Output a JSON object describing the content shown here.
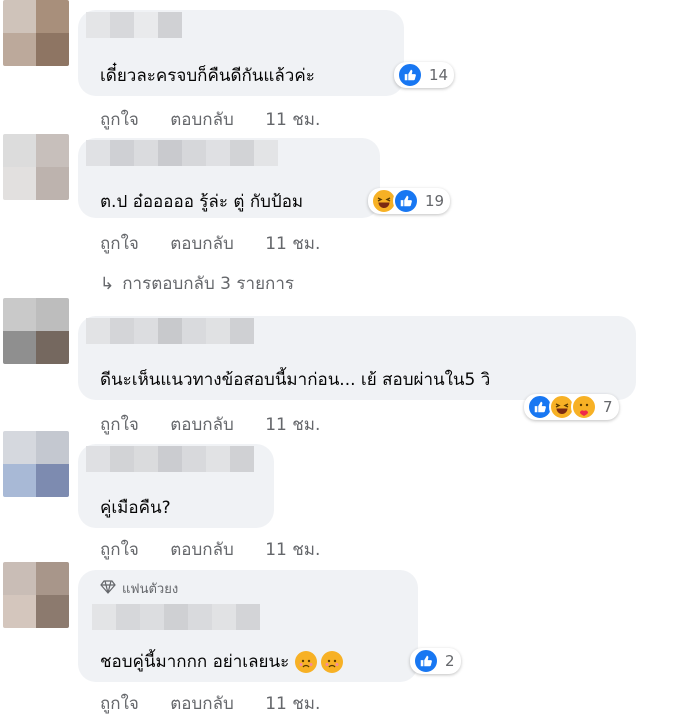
{
  "comments": [
    {
      "text": "เดี๋ยวละครจบก็คืนดีกันแล้วค่ะ",
      "reaction_count": "14",
      "actions": {
        "like": "ถูกใจ",
        "reply": "ตอบกลับ",
        "time": "11 ชม."
      }
    },
    {
      "text": "ต.ป อ๋อออออ รู้ล่ะ ตู่ กับป้อม",
      "reaction_count": "19",
      "actions": {
        "like": "ถูกใจ",
        "reply": "ตอบกลับ",
        "time": "11 ชม."
      },
      "replies_link": "การตอบกลับ 3 รายการ"
    },
    {
      "text": "ดีนะเห็นแนวทางข้อสอบนี้มาก่อน... เย้ สอบผ่านใน5 วิ",
      "reaction_count": "7",
      "actions": {
        "like": "ถูกใจ",
        "reply": "ตอบกลับ",
        "time": "11 ชม."
      }
    },
    {
      "text": "คู่เมือคืน?",
      "actions": {
        "like": "ถูกใจ",
        "reply": "ตอบกลับ",
        "time": "11 ชม."
      }
    },
    {
      "badge": "แฟนตัวยง",
      "text": "ชอบคู่นี้มากกก อย่าเลยนะ",
      "reaction_count": "2",
      "actions": {
        "like": "ถูกใจ",
        "reply": "ตอบกลับ",
        "time": "11 ชม."
      }
    }
  ],
  "icons": {
    "like": "like-reaction-icon",
    "haha": "haha-reaction-icon",
    "care": "care-reaction-icon",
    "sad": "sad-face-emoji-icon",
    "reply_arrow": "reply-arrow-icon",
    "badge": "diamond-icon"
  },
  "colors": {
    "bubble": "#f0f2f5",
    "like_blue": "#1877f2",
    "emoji_yellow": "#f7b125",
    "meta_text": "#65676b"
  }
}
